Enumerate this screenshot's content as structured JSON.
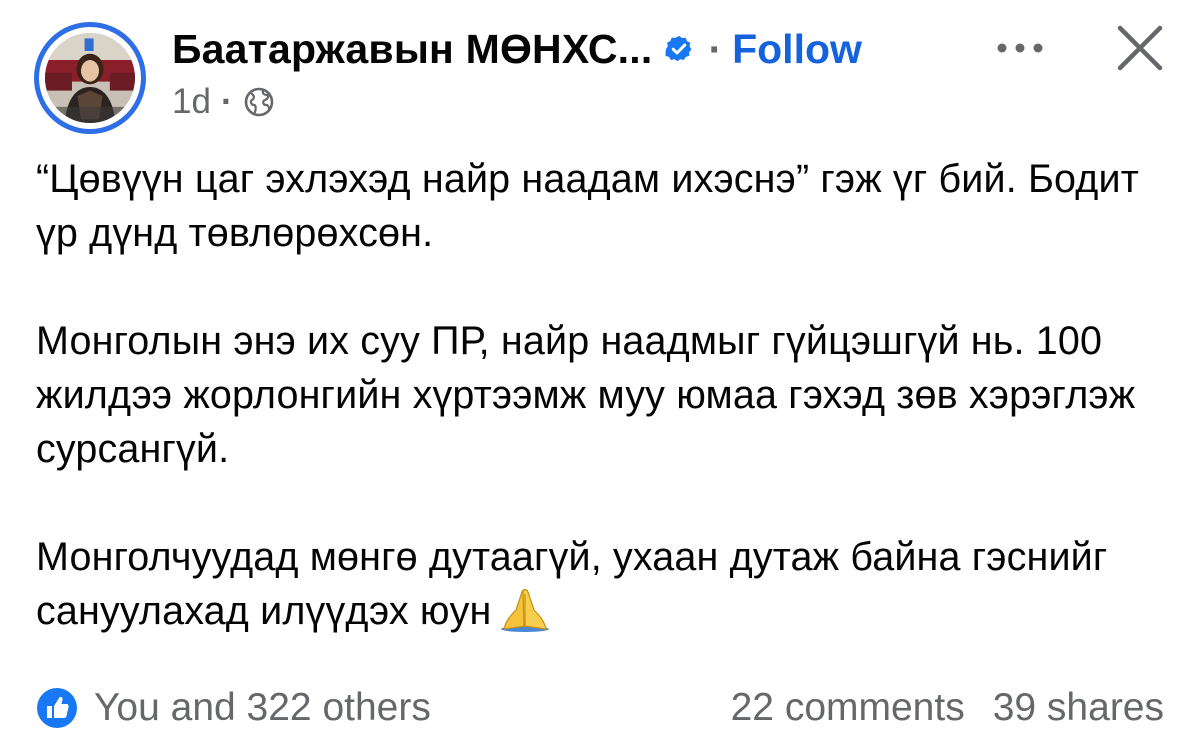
{
  "post": {
    "author_name": "Баатаржавын МӨНХС...",
    "separator": "·",
    "follow_label": "Follow",
    "timestamp": "1d",
    "meta_separator": "·",
    "verified_icon": "verified-badge-icon",
    "audience_icon": "globe-icon",
    "paragraphs": [
      "“Цөвүүн цаг эхлэхэд найр наадам ихэснэ” гэж үг бий. Бодит үр дүнд төвлөрөхсөн.",
      "Монголын энэ их суу ПР, найр наадмыг гүйцэшгүй нь. 100 жилдээ жорлонгийн хүртээмж муу юмаа гэхэд зөв хэрэглэж сурсангүй.",
      "Монголчуудад мөнгө дутаагүй, ухаан дутаж байна гэснийг сануулахад илүүдэх юун"
    ],
    "emoji": "folded-hands-emoji"
  },
  "footer": {
    "reactions_text": "You and 322 others",
    "comments_text": "22 comments",
    "shares_text": "39 shares"
  },
  "colors": {
    "follow": "#1463dc",
    "secondary_text": "#65676b",
    "avatar_ring": "#2e6ee6",
    "like_blue": "#1877f2"
  }
}
